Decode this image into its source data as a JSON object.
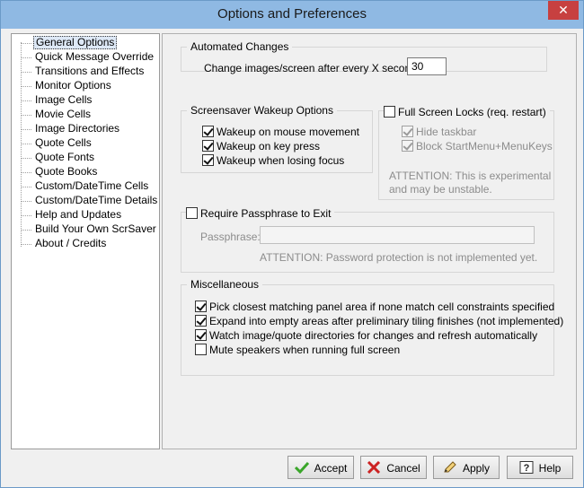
{
  "window": {
    "title": "Options and Preferences",
    "close_glyph": "✕"
  },
  "tree": {
    "items": [
      {
        "label": "General Options"
      },
      {
        "label": "Quick Message Override"
      },
      {
        "label": "Transitions and Effects"
      },
      {
        "label": "Monitor Options"
      },
      {
        "label": "Image Cells"
      },
      {
        "label": "Movie Cells"
      },
      {
        "label": "Image Directories"
      },
      {
        "label": "Quote Cells"
      },
      {
        "label": "Quote Fonts"
      },
      {
        "label": "Quote Books"
      },
      {
        "label": "Custom/DateTime Cells"
      },
      {
        "label": "Custom/DateTime Details"
      },
      {
        "label": "Help and Updates"
      },
      {
        "label": "Build Your Own ScrSaver"
      },
      {
        "label": "About / Credits"
      }
    ]
  },
  "automated": {
    "title": "Automated Changes",
    "label": "Change images/screen after every X seconds:",
    "value": "30"
  },
  "wakeup": {
    "title": "Screensaver Wakeup Options",
    "options": [
      {
        "label": "Wakeup on mouse movement"
      },
      {
        "label": "Wakeup on key press"
      },
      {
        "label": "Wakeup when losing focus"
      }
    ]
  },
  "fullscreen": {
    "title": "Full Screen Locks (req. restart)",
    "hide_taskbar": "Hide taskbar",
    "block_menu": "Block StartMenu+MenuKeys",
    "attention1": "ATTENTION: This is experimental",
    "attention2": "and may be unstable."
  },
  "passphrase": {
    "title": "Require Passphrase to Exit",
    "label": "Passphrase:",
    "value": "",
    "attention": "ATTENTION: Password protection is not implemented yet."
  },
  "misc": {
    "title": "Miscellaneous",
    "options": [
      {
        "label": "Pick closest matching panel area if none match cell constraints specified"
      },
      {
        "label": "Expand into empty areas after preliminary tiling finishes (not implemented)"
      },
      {
        "label": "Watch image/quote directories for changes and refresh automatically"
      },
      {
        "label": "Mute speakers when running full screen"
      }
    ]
  },
  "buttons": {
    "accept": "Accept",
    "cancel": "Cancel",
    "apply": "Apply",
    "help": "Help"
  },
  "colors": {
    "titlebar": "#8fb9e3",
    "close": "#c74040",
    "accept_icon": "#3aa62a",
    "cancel_icon": "#cc2222"
  }
}
